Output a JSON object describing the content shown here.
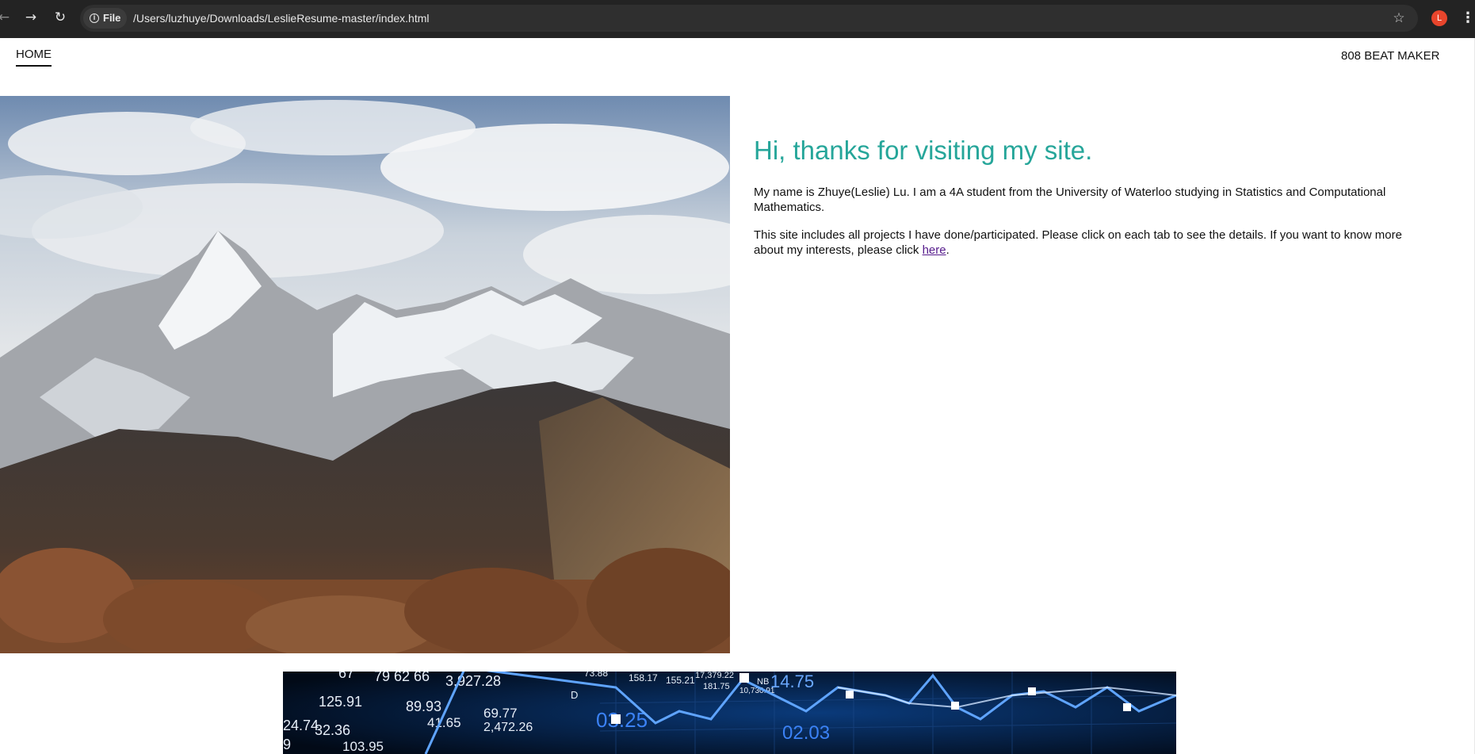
{
  "browser": {
    "security_chip": "File",
    "url": "/Users/luzhuye/Downloads/LeslieResume-master/index.html",
    "profile_initial": "L",
    "icons": {
      "back": "arrow-left-icon",
      "forward": "arrow-right-icon",
      "reload": "reload-icon",
      "info": "info-icon",
      "bookmark": "star-icon",
      "menu": "kebab-icon"
    },
    "colors": {
      "chrome_bg": "#232323",
      "omnibox_bg": "#2f2f2f",
      "avatar": "#e8452c"
    }
  },
  "nav": {
    "home": "HOME",
    "beat_maker": "808 BEAT MAKER"
  },
  "intro": {
    "heading": "Hi, thanks for visiting my site.",
    "para1": "My name is Zhuye(Leslie) Lu. I am a 4A student from the University of Waterloo studying in Statistics and Computational Mathematics.",
    "para2_prefix": "This site includes all projects I have done/participated. Please click on each tab to see the details. If you want to know more about my interests, please click ",
    "para2_link": "here",
    "para2_suffix": ".",
    "heading_color": "#26a69a"
  },
  "banner": {
    "numbers": [
      "67",
      "79",
      "62",
      "66",
      "3,927.28",
      "125.91",
      "89.93",
      "41.65",
      "69.77",
      "2,472.26",
      "24.74",
      "32.36",
      "103.95",
      "9",
      "158.17",
      "155.21",
      "181.75",
      "10,730.91",
      "14.75",
      "03.25",
      "02.03",
      "73.88",
      "17,379.22",
      "NB",
      "D"
    ]
  }
}
